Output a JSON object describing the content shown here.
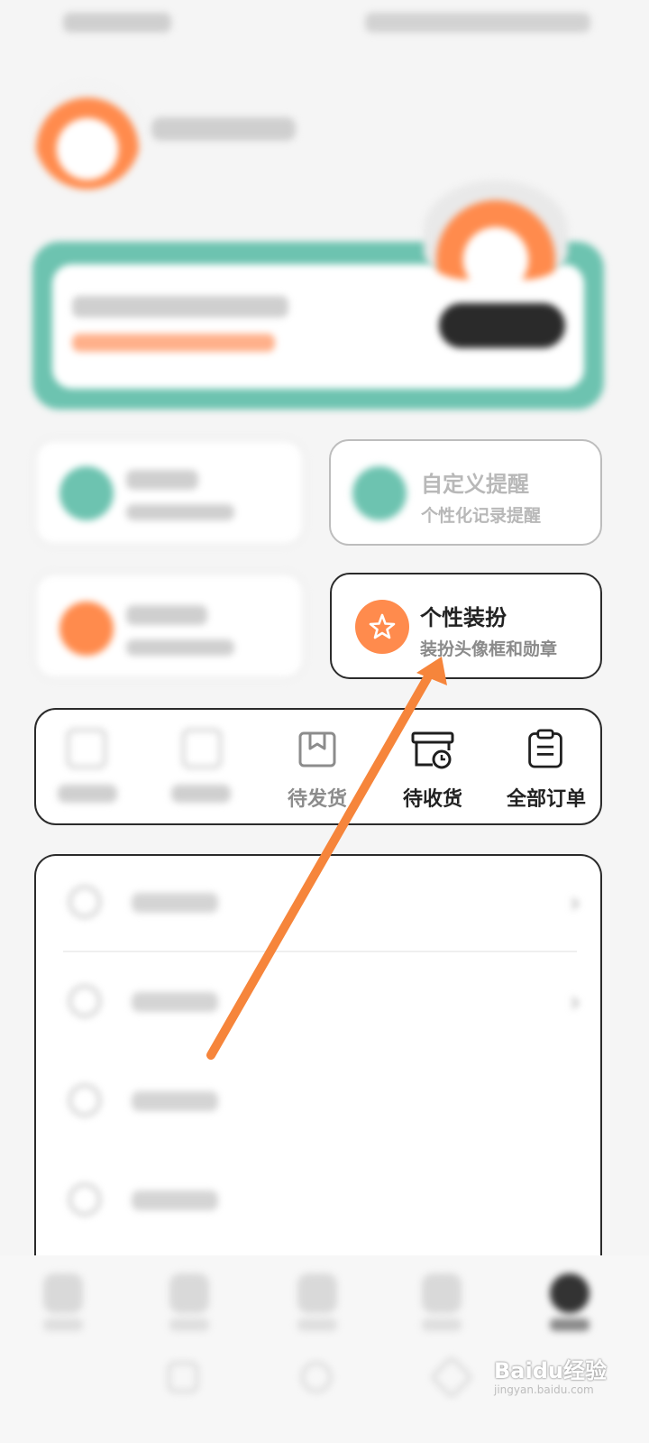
{
  "cards": {
    "custom_reminder": {
      "title": "自定义提醒",
      "subtitle": "个性化记录提醒"
    },
    "dress_up": {
      "title": "个性装扮",
      "subtitle": "装扮头像框和勋章"
    }
  },
  "orders": {
    "pending_ship": "待发货",
    "pending_receive": "待收货",
    "all_orders": "全部订单"
  },
  "menu": {
    "chevron": "›"
  },
  "watermark": {
    "main": "Baidu经验",
    "sub": "jingyan.baidu.com"
  },
  "colors": {
    "teal": "#6dc3b0",
    "orange": "#ff8b4d",
    "annotation_arrow": "#f6853b"
  }
}
